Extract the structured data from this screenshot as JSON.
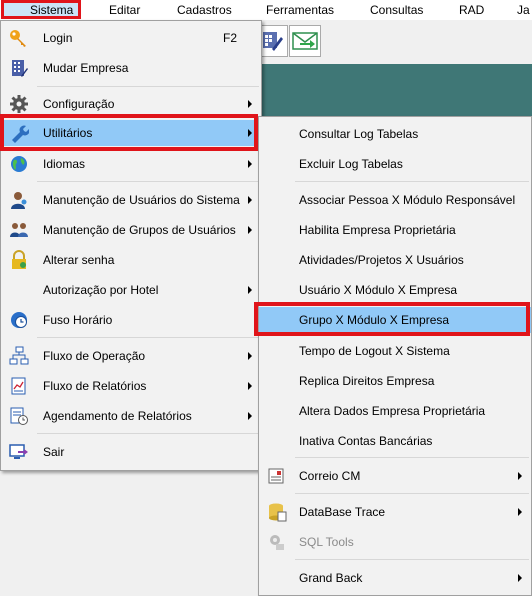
{
  "menubar": {
    "items": [
      "Sistema",
      "Editar",
      "Cadastros",
      "Ferramentas",
      "Consultas",
      "RAD",
      "Ja"
    ]
  },
  "main_menu": {
    "items": [
      {
        "label": "Login",
        "shortcut": "F2",
        "icon": "key-icon"
      },
      {
        "label": "Mudar Empresa",
        "icon": "building-icon"
      },
      {
        "label": "Configuração",
        "icon": "gear-icon",
        "submenu": true
      },
      {
        "label": "Utilitários",
        "icon": "wrench-icon",
        "submenu": true,
        "highlighted": true
      },
      {
        "label": "Idiomas",
        "icon": "globe-icon",
        "submenu": true
      },
      {
        "label": "Manutenção de Usuários do Sistema",
        "icon": "user-icon",
        "submenu": true
      },
      {
        "label": "Manutenção de Grupos de Usuários",
        "icon": "users-group-icon",
        "submenu": true
      },
      {
        "label": "Alterar senha",
        "icon": "lock-icon"
      },
      {
        "label": "Autorização por Hotel",
        "submenu": true
      },
      {
        "label": "Fuso Horário",
        "icon": "clock-globe-icon"
      },
      {
        "label": "Fluxo de Operação",
        "icon": "flowchart-icon",
        "submenu": true
      },
      {
        "label": "Fluxo de Relatórios",
        "icon": "report-flow-icon",
        "submenu": true
      },
      {
        "label": "Agendamento de Relatórios",
        "icon": "schedule-icon",
        "submenu": true
      },
      {
        "label": "Sair",
        "icon": "exit-icon"
      }
    ]
  },
  "sub_menu": {
    "items": [
      {
        "label": "Consultar Log Tabelas"
      },
      {
        "label": "Excluir Log Tabelas"
      },
      {
        "label": "Associar Pessoa X Módulo Responsável"
      },
      {
        "label": "Habilita Empresa Proprietária"
      },
      {
        "label": "Atividades/Projetos X Usuários"
      },
      {
        "label": "Usuário X Módulo X Empresa"
      },
      {
        "label": "Grupo X Módulo X Empresa",
        "highlighted": true
      },
      {
        "label": "Tempo de Logout X Sistema"
      },
      {
        "label": "Replica Direitos Empresa"
      },
      {
        "label": "Altera Dados Empresa Proprietária"
      },
      {
        "label": "Inativa Contas Bancárias"
      },
      {
        "label": "Correio CM",
        "icon": "mail-icon",
        "submenu": true
      },
      {
        "label": "DataBase Trace",
        "icon": "database-icon",
        "submenu": true
      },
      {
        "label": "SQL Tools",
        "icon": "sql-tools-icon",
        "disabled": true
      },
      {
        "label": "Grand Back",
        "submenu": true
      }
    ]
  },
  "colors": {
    "highlight": "#91c9f7",
    "annotation": "#e0141a",
    "workspace": "#3f7776"
  }
}
